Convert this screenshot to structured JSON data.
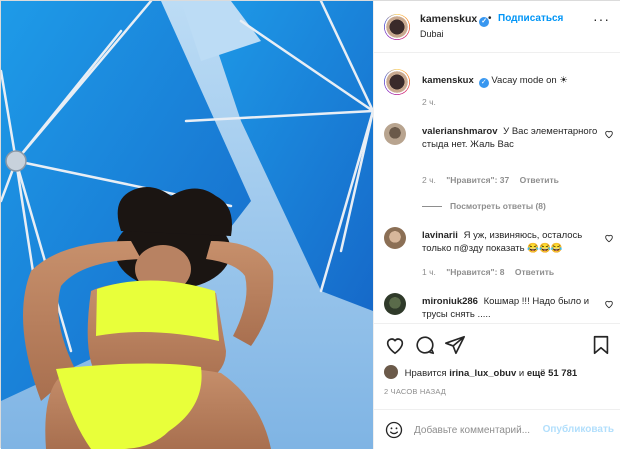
{
  "post": {
    "username": "kamenskux",
    "location": "Dubai",
    "follow_label": "Подписаться",
    "separator": "•",
    "more_icon": "ellipsis-icon"
  },
  "caption": {
    "username": "kamenskux",
    "text": "Vacay mode on ☀",
    "time": "2 ч."
  },
  "comments": [
    {
      "username": "valerianshmarov",
      "text": "У Вас элементарного стыда нет. Жаль Вас",
      "time": "2 ч.",
      "likes": "\"Нравится\": 37",
      "reply": "Ответить",
      "view_replies": "Посмотреть ответы (8)"
    },
    {
      "username": "lavinarii",
      "text": "Я уж, извиняюсь, осталось только п@зду показать 😂😂😂",
      "time": "1 ч.",
      "likes": "\"Нравится\": 8",
      "reply": "Ответить"
    },
    {
      "username": "mironiuk286",
      "text": "Кошмар !!! Надо было и трусы снять .....",
      "time": "",
      "likes": "",
      "reply": ""
    }
  ],
  "likes_line": {
    "prefix": "Нравится",
    "user": "irina_lux_obuv",
    "middle": "и",
    "rest": "ещё 51 781"
  },
  "posted_ago": "2 ЧАСОВ НАЗАД",
  "add_comment": {
    "placeholder": "Добавьте комментарий...",
    "publish_label": "Опубликовать"
  },
  "colors": {
    "accent": "#0095f6",
    "sky": "#9ec9ee",
    "umbrella": "#1e88e5",
    "swimsuit": "#e8ff3a"
  }
}
